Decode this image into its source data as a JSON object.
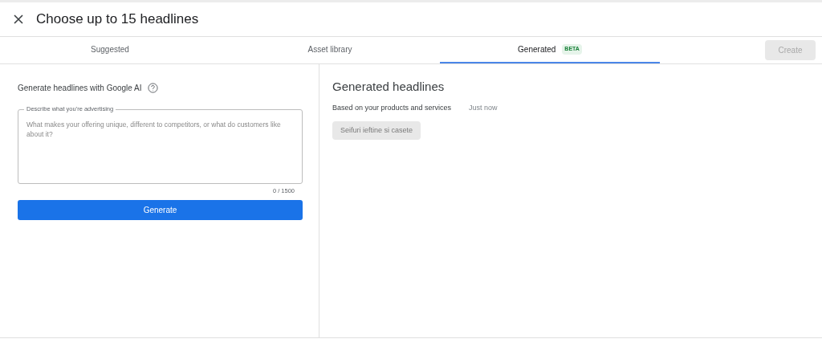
{
  "dialog": {
    "title": "Choose up to 15 headlines"
  },
  "tabs": [
    {
      "label": "Suggested",
      "selected": false
    },
    {
      "label": "Asset library",
      "selected": false
    },
    {
      "label": "Generated",
      "badge": "BETA",
      "selected": true
    }
  ],
  "create_button": {
    "label": "Create",
    "disabled": true
  },
  "generator": {
    "heading": "Generate headlines with Google AI",
    "field_label": "Describe what you're advertising",
    "placeholder": "What makes your offering unique, different to competitors, or what do customers like about it?",
    "counter": "0 / 1500",
    "button": "Generate"
  },
  "results": {
    "heading": "Generated headlines",
    "source": "Based on your products and services",
    "time": "Just now",
    "headlines": [
      {
        "text": "Seifuri ieftine si casete",
        "disabled": true
      }
    ]
  }
}
